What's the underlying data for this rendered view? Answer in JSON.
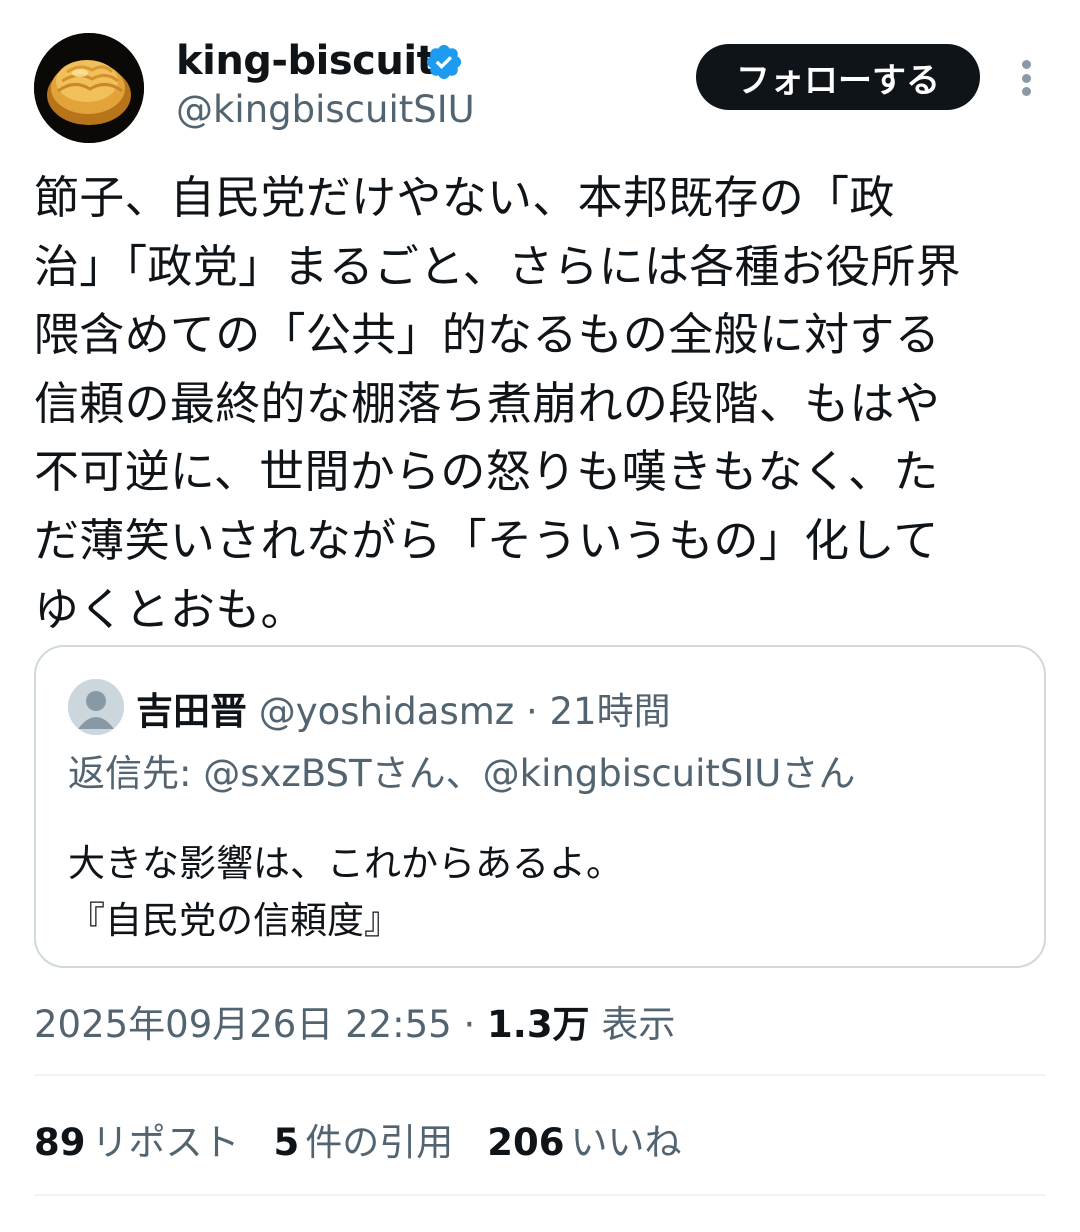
{
  "author": {
    "display_name": "king-biscuit",
    "handle": "@kingbiscuitSIU",
    "verified_icon": "verified-badge-icon",
    "verified_color": "#1d9bf0"
  },
  "actions": {
    "follow_label": "フォローする",
    "more_icon": "more-vertical-icon"
  },
  "tweet": {
    "lines": [
      "節子、自民党だけやない、本邦既存の「政",
      "治」「政党」まるごと、さらには各種お役所界",
      "隈含めての「公共」的なるもの全般に対する",
      "信頼の最終的な棚落ち煮崩れの段階、もはや",
      "不可逆に、世間からの怒りも嘆きもなく、た",
      "だ薄笑いされながら「そういうもの」化して",
      "ゆくとおも。"
    ]
  },
  "quote": {
    "avatar_icon": "default-avatar-icon",
    "name": "吉田晋",
    "handle": "@yoshidasmz",
    "separator": "·",
    "time": "21時間",
    "reply_to": "返信先: @sxzBSTさん、@kingbiscuitSIUさん",
    "lines": [
      "大きな影響は、これからあるよ。",
      "『自民党の信頼度』"
    ]
  },
  "meta": {
    "datetime": "2025年09月26日 22:55",
    "separator": "·",
    "views_count": "1.3万",
    "views_label": "表示"
  },
  "stats": {
    "reposts_count": "89",
    "reposts_label": "リポスト",
    "quotes_count": "5",
    "quotes_label": "件の引用",
    "likes_count": "206",
    "likes_label": "いいね"
  }
}
